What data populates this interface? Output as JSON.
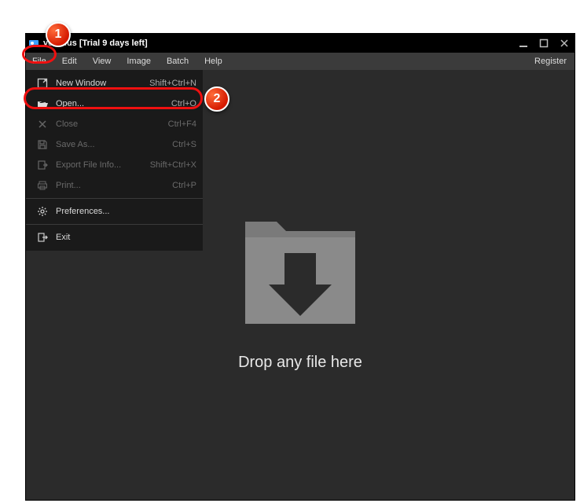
{
  "titlebar": {
    "title_fragment": "ver Plus [Trial 9 days left]"
  },
  "menubar": {
    "items": [
      "File",
      "Edit",
      "View",
      "Image",
      "Batch",
      "Help"
    ],
    "register": "Register"
  },
  "dropdown": {
    "items": [
      {
        "icon": "new-window-icon",
        "label": "New Window",
        "shortcut": "Shift+Ctrl+N",
        "enabled": true
      },
      {
        "icon": "folder-open-icon",
        "label": "Open...",
        "shortcut": "Ctrl+O",
        "enabled": true,
        "highlight": true
      },
      {
        "icon": "close-icon",
        "label": "Close",
        "shortcut": "Ctrl+F4",
        "enabled": false
      },
      {
        "icon": "save-icon",
        "label": "Save As...",
        "shortcut": "Ctrl+S",
        "enabled": false
      },
      {
        "icon": "export-icon",
        "label": "Export File Info...",
        "shortcut": "Shift+Ctrl+X",
        "enabled": false
      },
      {
        "icon": "print-icon",
        "label": "Print...",
        "shortcut": "Ctrl+P",
        "enabled": false
      },
      {
        "sep": true
      },
      {
        "icon": "gear-icon",
        "label": "Preferences...",
        "shortcut": "",
        "enabled": true
      },
      {
        "sep": true
      },
      {
        "icon": "exit-icon",
        "label": "Exit",
        "shortcut": "",
        "enabled": true
      }
    ]
  },
  "content": {
    "drop_hint": "Drop any file here"
  },
  "annotations": {
    "badge1": "1",
    "badge2": "2"
  }
}
